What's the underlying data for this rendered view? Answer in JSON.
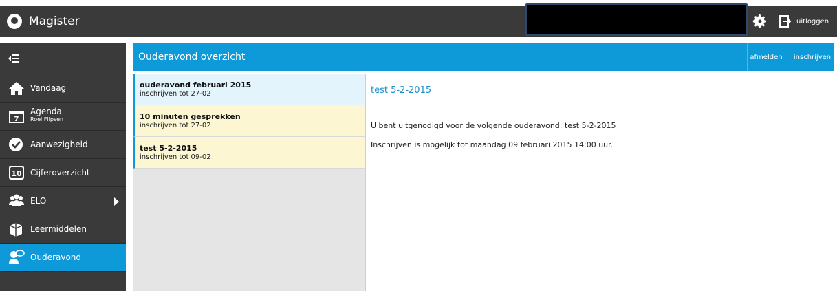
{
  "app": {
    "title": "Magister"
  },
  "header": {
    "logout_label": "uitloggen"
  },
  "sidebar": {
    "items": [
      {
        "label": "Vandaag",
        "icon": "home-icon"
      },
      {
        "label": "Agenda",
        "sublabel": "Roel Flipsen",
        "icon": "calendar-icon"
      },
      {
        "label": "Aanwezigheid",
        "icon": "check-circle-icon"
      },
      {
        "label": "Cijferoverzicht",
        "icon": "grade-10-icon"
      },
      {
        "label": "ELO",
        "icon": "people-icon"
      },
      {
        "label": "Leermiddelen",
        "icon": "books-icon"
      },
      {
        "label": "Ouderavond",
        "icon": "parent-evening-icon",
        "active": true
      }
    ]
  },
  "main": {
    "title": "Ouderavond overzicht",
    "actions": {
      "afmelden": "afmelden",
      "inschrijven": "inschrijven"
    }
  },
  "list": [
    {
      "title": "ouderavond februari 2015",
      "subtitle": "inschrijven tot 27-02"
    },
    {
      "title": "10 minuten gesprekken",
      "subtitle": "inschrijven tot 27-02"
    },
    {
      "title": "test 5-2-2015",
      "subtitle": "inschrijven tot 09-02"
    }
  ],
  "detail": {
    "title": "test 5-2-2015",
    "line1": "U bent uitgenodigd voor de volgende ouderavond: test 5-2-2015",
    "line2": "Inschrijven is mogelijk tot maandag 09 februari 2015 14:00 uur."
  },
  "colors": {
    "accent": "#0e9ad8",
    "dark": "#3a3a3a",
    "list_item": "#fdf6d3",
    "list_selected": "#e4f4fd"
  }
}
